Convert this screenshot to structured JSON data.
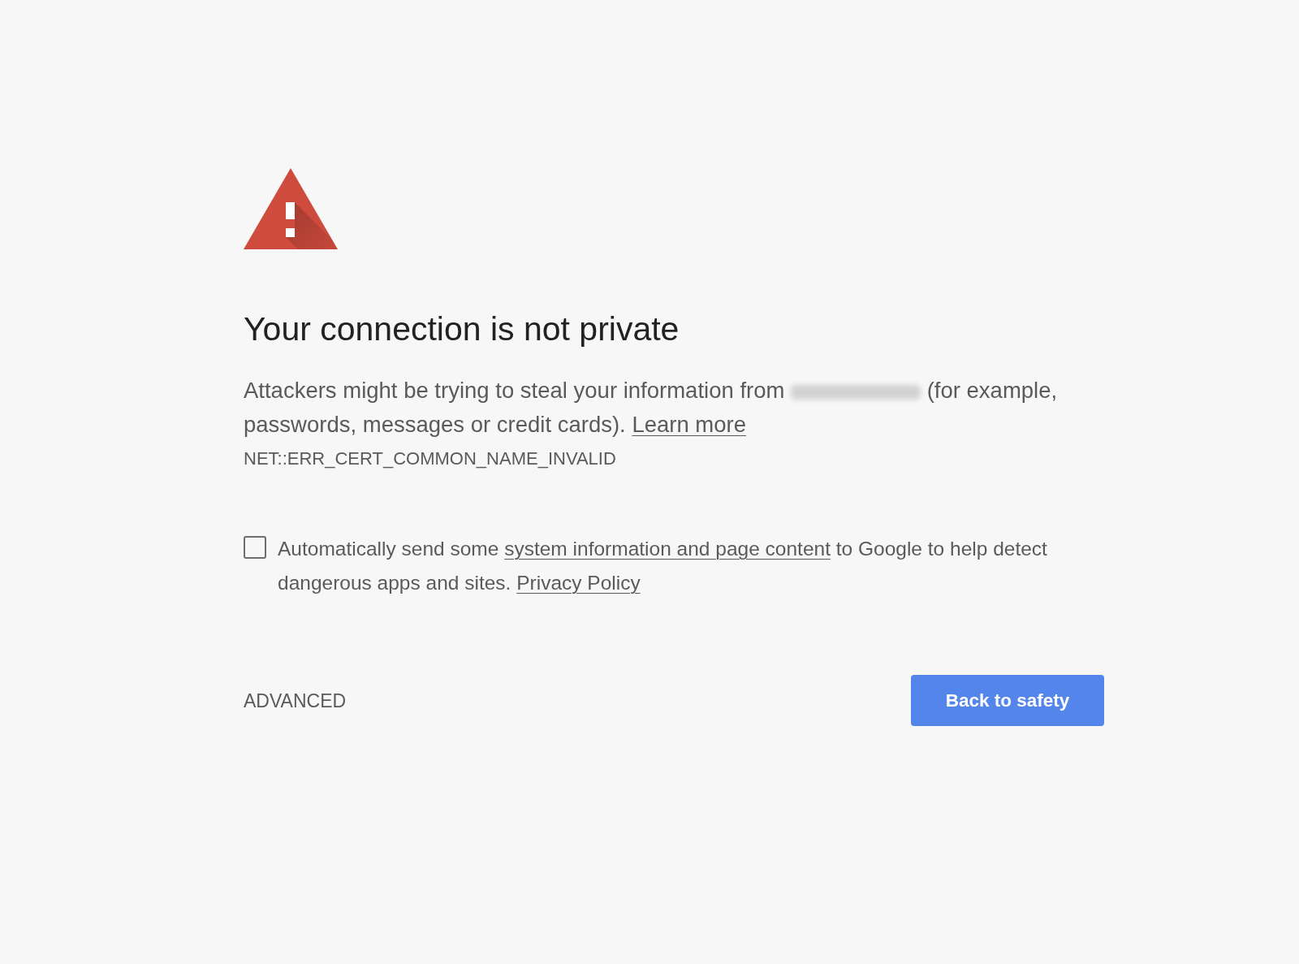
{
  "title": "Your connection is not private",
  "message": {
    "text_before": "Attackers might be trying to steal your information from",
    "blurred_domain": true,
    "text_after": "(for example, passwords, messages or credit cards).",
    "link": "Learn more"
  },
  "error_code": "NET::ERR_CERT_COMMON_NAME_INVALID",
  "report_option": {
    "checked": false,
    "text_before": "Automatically send some",
    "link": "system information and page content",
    "text_after": "to Google to help detect dangerous apps and sites.",
    "policy_link": "Privacy Policy"
  },
  "advanced_link": "ADVANCED",
  "primary_button": "Back to safety"
}
